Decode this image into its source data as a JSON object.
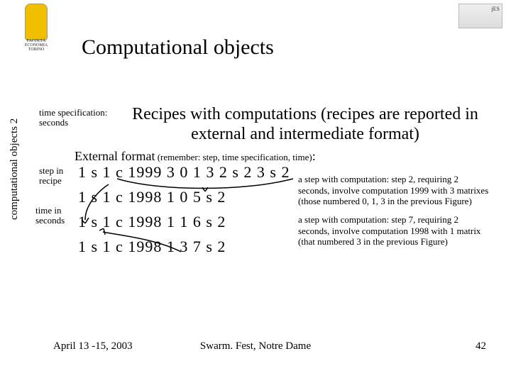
{
  "logo_left_caption": "FACOLTÀ ECONOMIA TORINO",
  "logo_right_label": "jES",
  "title": "Computational objects",
  "side_label": "computational objects 2",
  "heading": "Recipes with computations (recipes are reported in external and intermediate format)",
  "subhead_strong": "External format",
  "subhead_small": " (remember: step, time specification, time)",
  "subhead_tail": ":",
  "annot": {
    "time_spec": "time specification: seconds",
    "step_in": "step in recipe",
    "time_in": "time in seconds"
  },
  "code": {
    "l1": "1 s 1 c 1999 3 0 1 3 2 s 2 3 s 2",
    "l2": "1 s 1 c 1998 1 0 5 s 2",
    "l3": "1 s 1 c 1998 1 1 6 s 2",
    "l4": "1 s 1 c 1998 1 3 7 s 2"
  },
  "notes": {
    "n1": "a step with computation: step 2, requiring 2 seconds, involve computation 1999 with 3 matrixes (those numbered 0, 1, 3 in the previous Figure)",
    "n2": "a step with computation: step 7, requiring 2 seconds, involve computation 1998 with 1 matrix (that numbered 3 in the previous Figure)"
  },
  "footer": {
    "left": "April 13 -15, 2003",
    "center": "Swarm. Fest, Notre Dame",
    "right": "42"
  }
}
